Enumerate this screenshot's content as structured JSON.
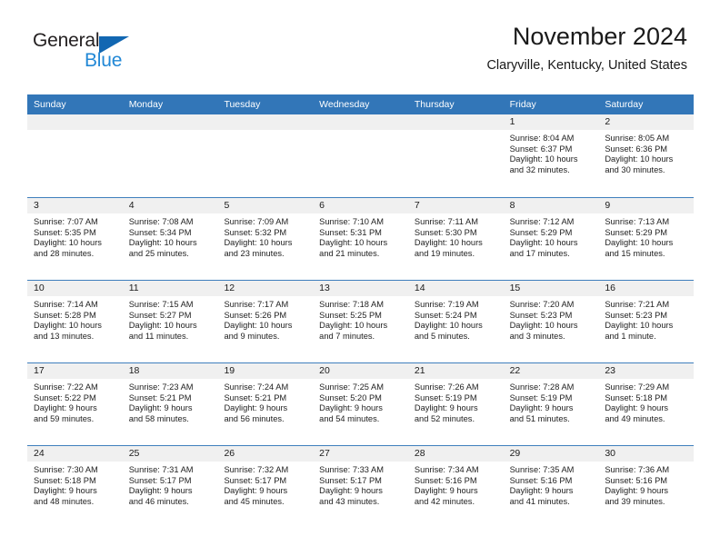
{
  "brand": {
    "name_part1": "General",
    "name_part2": "Blue",
    "triangle_color": "#1267b2",
    "blue_text_color": "#2288d6"
  },
  "header": {
    "title": "November 2024",
    "location": "Claryville, Kentucky, United States"
  },
  "theme": {
    "header_bg": "#3276b8",
    "header_text": "#ffffff",
    "daynum_bg": "#f0f0f0",
    "row_border": "#3f7fbd"
  },
  "weekdays": [
    "Sunday",
    "Monday",
    "Tuesday",
    "Wednesday",
    "Thursday",
    "Friday",
    "Saturday"
  ],
  "weeks": [
    [
      {
        "day": "",
        "sunrise": "",
        "sunset": "",
        "daylight1": "",
        "daylight2": ""
      },
      {
        "day": "",
        "sunrise": "",
        "sunset": "",
        "daylight1": "",
        "daylight2": ""
      },
      {
        "day": "",
        "sunrise": "",
        "sunset": "",
        "daylight1": "",
        "daylight2": ""
      },
      {
        "day": "",
        "sunrise": "",
        "sunset": "",
        "daylight1": "",
        "daylight2": ""
      },
      {
        "day": "",
        "sunrise": "",
        "sunset": "",
        "daylight1": "",
        "daylight2": ""
      },
      {
        "day": "1",
        "sunrise": "Sunrise: 8:04 AM",
        "sunset": "Sunset: 6:37 PM",
        "daylight1": "Daylight: 10 hours",
        "daylight2": "and 32 minutes."
      },
      {
        "day": "2",
        "sunrise": "Sunrise: 8:05 AM",
        "sunset": "Sunset: 6:36 PM",
        "daylight1": "Daylight: 10 hours",
        "daylight2": "and 30 minutes."
      }
    ],
    [
      {
        "day": "3",
        "sunrise": "Sunrise: 7:07 AM",
        "sunset": "Sunset: 5:35 PM",
        "daylight1": "Daylight: 10 hours",
        "daylight2": "and 28 minutes."
      },
      {
        "day": "4",
        "sunrise": "Sunrise: 7:08 AM",
        "sunset": "Sunset: 5:34 PM",
        "daylight1": "Daylight: 10 hours",
        "daylight2": "and 25 minutes."
      },
      {
        "day": "5",
        "sunrise": "Sunrise: 7:09 AM",
        "sunset": "Sunset: 5:32 PM",
        "daylight1": "Daylight: 10 hours",
        "daylight2": "and 23 minutes."
      },
      {
        "day": "6",
        "sunrise": "Sunrise: 7:10 AM",
        "sunset": "Sunset: 5:31 PM",
        "daylight1": "Daylight: 10 hours",
        "daylight2": "and 21 minutes."
      },
      {
        "day": "7",
        "sunrise": "Sunrise: 7:11 AM",
        "sunset": "Sunset: 5:30 PM",
        "daylight1": "Daylight: 10 hours",
        "daylight2": "and 19 minutes."
      },
      {
        "day": "8",
        "sunrise": "Sunrise: 7:12 AM",
        "sunset": "Sunset: 5:29 PM",
        "daylight1": "Daylight: 10 hours",
        "daylight2": "and 17 minutes."
      },
      {
        "day": "9",
        "sunrise": "Sunrise: 7:13 AM",
        "sunset": "Sunset: 5:29 PM",
        "daylight1": "Daylight: 10 hours",
        "daylight2": "and 15 minutes."
      }
    ],
    [
      {
        "day": "10",
        "sunrise": "Sunrise: 7:14 AM",
        "sunset": "Sunset: 5:28 PM",
        "daylight1": "Daylight: 10 hours",
        "daylight2": "and 13 minutes."
      },
      {
        "day": "11",
        "sunrise": "Sunrise: 7:15 AM",
        "sunset": "Sunset: 5:27 PM",
        "daylight1": "Daylight: 10 hours",
        "daylight2": "and 11 minutes."
      },
      {
        "day": "12",
        "sunrise": "Sunrise: 7:17 AM",
        "sunset": "Sunset: 5:26 PM",
        "daylight1": "Daylight: 10 hours",
        "daylight2": "and 9 minutes."
      },
      {
        "day": "13",
        "sunrise": "Sunrise: 7:18 AM",
        "sunset": "Sunset: 5:25 PM",
        "daylight1": "Daylight: 10 hours",
        "daylight2": "and 7 minutes."
      },
      {
        "day": "14",
        "sunrise": "Sunrise: 7:19 AM",
        "sunset": "Sunset: 5:24 PM",
        "daylight1": "Daylight: 10 hours",
        "daylight2": "and 5 minutes."
      },
      {
        "day": "15",
        "sunrise": "Sunrise: 7:20 AM",
        "sunset": "Sunset: 5:23 PM",
        "daylight1": "Daylight: 10 hours",
        "daylight2": "and 3 minutes."
      },
      {
        "day": "16",
        "sunrise": "Sunrise: 7:21 AM",
        "sunset": "Sunset: 5:23 PM",
        "daylight1": "Daylight: 10 hours",
        "daylight2": "and 1 minute."
      }
    ],
    [
      {
        "day": "17",
        "sunrise": "Sunrise: 7:22 AM",
        "sunset": "Sunset: 5:22 PM",
        "daylight1": "Daylight: 9 hours",
        "daylight2": "and 59 minutes."
      },
      {
        "day": "18",
        "sunrise": "Sunrise: 7:23 AM",
        "sunset": "Sunset: 5:21 PM",
        "daylight1": "Daylight: 9 hours",
        "daylight2": "and 58 minutes."
      },
      {
        "day": "19",
        "sunrise": "Sunrise: 7:24 AM",
        "sunset": "Sunset: 5:21 PM",
        "daylight1": "Daylight: 9 hours",
        "daylight2": "and 56 minutes."
      },
      {
        "day": "20",
        "sunrise": "Sunrise: 7:25 AM",
        "sunset": "Sunset: 5:20 PM",
        "daylight1": "Daylight: 9 hours",
        "daylight2": "and 54 minutes."
      },
      {
        "day": "21",
        "sunrise": "Sunrise: 7:26 AM",
        "sunset": "Sunset: 5:19 PM",
        "daylight1": "Daylight: 9 hours",
        "daylight2": "and 52 minutes."
      },
      {
        "day": "22",
        "sunrise": "Sunrise: 7:28 AM",
        "sunset": "Sunset: 5:19 PM",
        "daylight1": "Daylight: 9 hours",
        "daylight2": "and 51 minutes."
      },
      {
        "day": "23",
        "sunrise": "Sunrise: 7:29 AM",
        "sunset": "Sunset: 5:18 PM",
        "daylight1": "Daylight: 9 hours",
        "daylight2": "and 49 minutes."
      }
    ],
    [
      {
        "day": "24",
        "sunrise": "Sunrise: 7:30 AM",
        "sunset": "Sunset: 5:18 PM",
        "daylight1": "Daylight: 9 hours",
        "daylight2": "and 48 minutes."
      },
      {
        "day": "25",
        "sunrise": "Sunrise: 7:31 AM",
        "sunset": "Sunset: 5:17 PM",
        "daylight1": "Daylight: 9 hours",
        "daylight2": "and 46 minutes."
      },
      {
        "day": "26",
        "sunrise": "Sunrise: 7:32 AM",
        "sunset": "Sunset: 5:17 PM",
        "daylight1": "Daylight: 9 hours",
        "daylight2": "and 45 minutes."
      },
      {
        "day": "27",
        "sunrise": "Sunrise: 7:33 AM",
        "sunset": "Sunset: 5:17 PM",
        "daylight1": "Daylight: 9 hours",
        "daylight2": "and 43 minutes."
      },
      {
        "day": "28",
        "sunrise": "Sunrise: 7:34 AM",
        "sunset": "Sunset: 5:16 PM",
        "daylight1": "Daylight: 9 hours",
        "daylight2": "and 42 minutes."
      },
      {
        "day": "29",
        "sunrise": "Sunrise: 7:35 AM",
        "sunset": "Sunset: 5:16 PM",
        "daylight1": "Daylight: 9 hours",
        "daylight2": "and 41 minutes."
      },
      {
        "day": "30",
        "sunrise": "Sunrise: 7:36 AM",
        "sunset": "Sunset: 5:16 PM",
        "daylight1": "Daylight: 9 hours",
        "daylight2": "and 39 minutes."
      }
    ]
  ]
}
